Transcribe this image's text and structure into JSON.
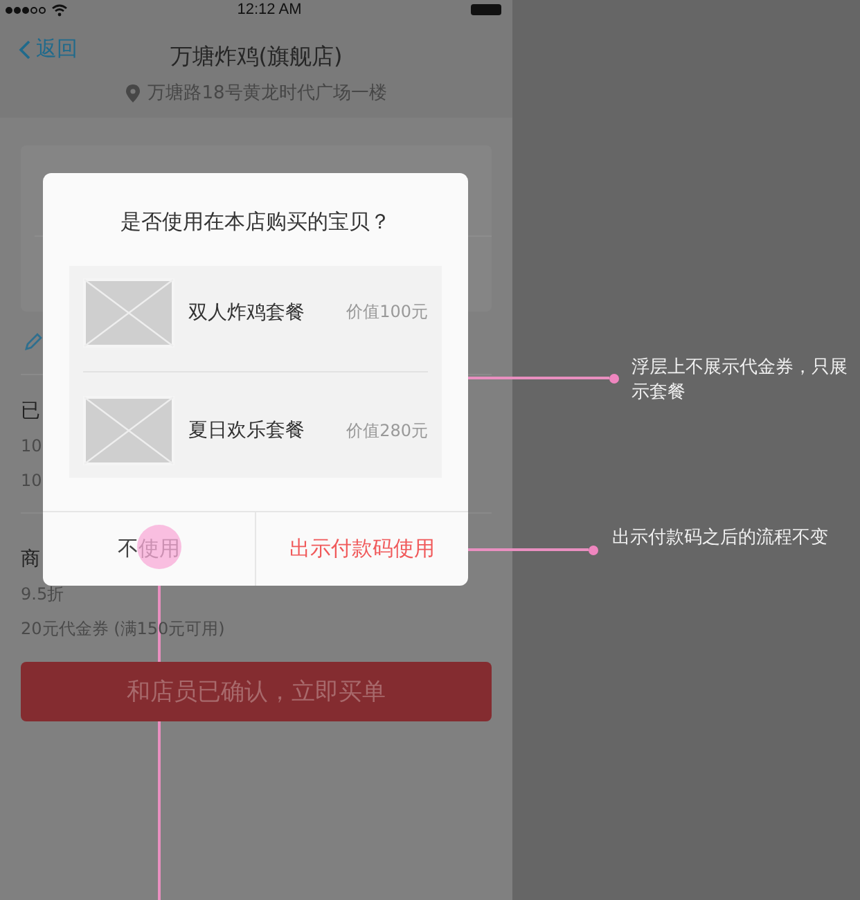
{
  "status_bar": {
    "time": "12:12 AM"
  },
  "nav": {
    "back": "返回",
    "title": "万塘炸鸡(旗舰店)",
    "address": "万塘路18号黄龙时代广场一楼"
  },
  "background_texts": [
    "已",
    "10",
    "10"
  ],
  "section": {
    "label": "商",
    "discount": "9.5折",
    "voucher": "20元代金券 (满150元可用)"
  },
  "confirm_button": "和店员已确认，立即买单",
  "dialog": {
    "title": "是否使用在本店购买的宝贝？",
    "items": [
      {
        "name": "双人炸鸡套餐",
        "price": "价值100元"
      },
      {
        "name": "夏日欢乐套餐",
        "price": "价值280元"
      }
    ],
    "buttons": [
      {
        "label": "不使用",
        "kind": "secondary"
      },
      {
        "label": "出示付款码使用",
        "kind": "primary"
      }
    ]
  },
  "annotations": [
    "浮层上不展示代金券，只展示套餐",
    "出示付款码之后的流程不变"
  ]
}
